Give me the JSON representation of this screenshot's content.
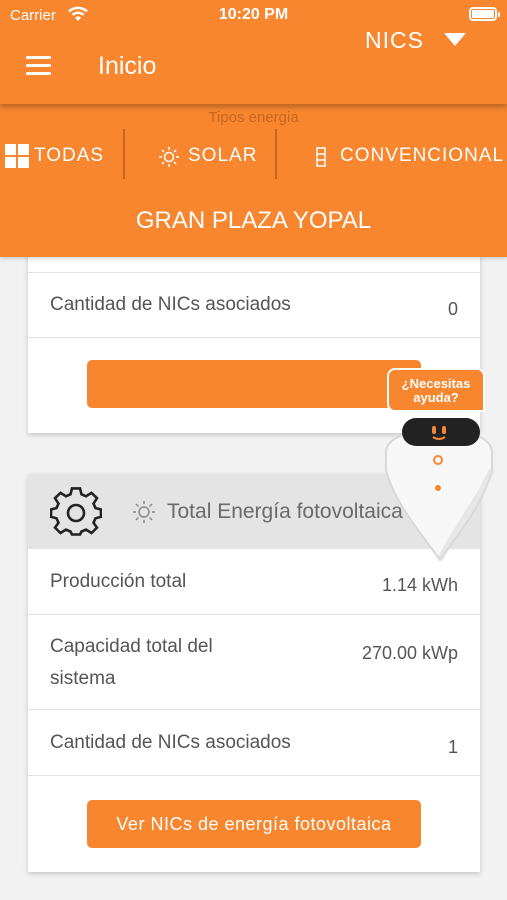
{
  "status_bar": {
    "carrier": "Carrier",
    "time": "10:20 PM"
  },
  "header": {
    "title": "Inicio",
    "nics_label": "NICS"
  },
  "energy_types": {
    "label": "Tipos energia",
    "tabs": [
      "TODAS",
      "SOLAR",
      "CONVENCIONAL"
    ]
  },
  "location": "GRAN PLAZA YOPAL",
  "card_top": {
    "row_label": "Cantidad de NICs asociados",
    "row_value": "0",
    "button_label": ""
  },
  "card_solar": {
    "header": "Total Energía fotovoltaica",
    "rows": [
      {
        "label": "Producción total",
        "value": "1.14 kWh"
      },
      {
        "label": "Capacidad total del sistema",
        "value": "270.00 kWp"
      },
      {
        "label": "Cantidad de NICs asociados",
        "value": "1"
      }
    ],
    "button_label": "Ver NICs de energía fotovoltaica"
  },
  "help": {
    "text": "¿Necesitas ayuda?"
  },
  "colors": {
    "accent": "#f7862f",
    "divider": "#c9661d",
    "card_header": "#e4e4e4",
    "background": "#f2f2f2"
  },
  "icons": [
    "wifi-icon",
    "battery-icon",
    "menu-icon",
    "caret-down-icon",
    "grid-icon",
    "sun-icon",
    "tower-icon",
    "gear-icon",
    "robot-icon"
  ]
}
